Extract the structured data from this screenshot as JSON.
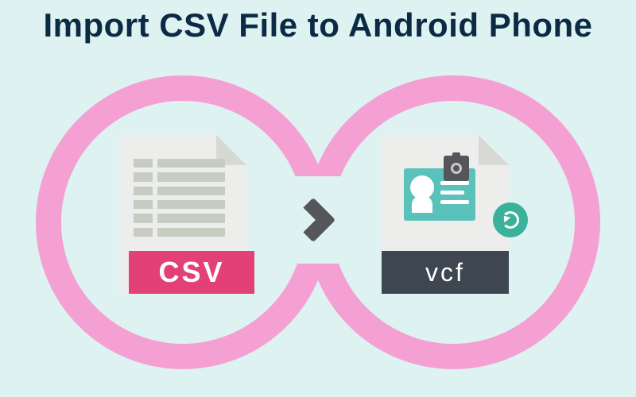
{
  "title": "Import CSV File to Android Phone",
  "source": {
    "format_label": "CSV"
  },
  "target": {
    "format_label": "vcf"
  },
  "colors": {
    "background": "#def2f2",
    "ring": "#f5a0d3",
    "csv_badge": "#e24076",
    "vcf_badge": "#3d4651",
    "contact_card": "#5bc2bb",
    "refresh": "#3ab19a",
    "arrow": "#55565a",
    "title_text": "#0b2b44"
  }
}
